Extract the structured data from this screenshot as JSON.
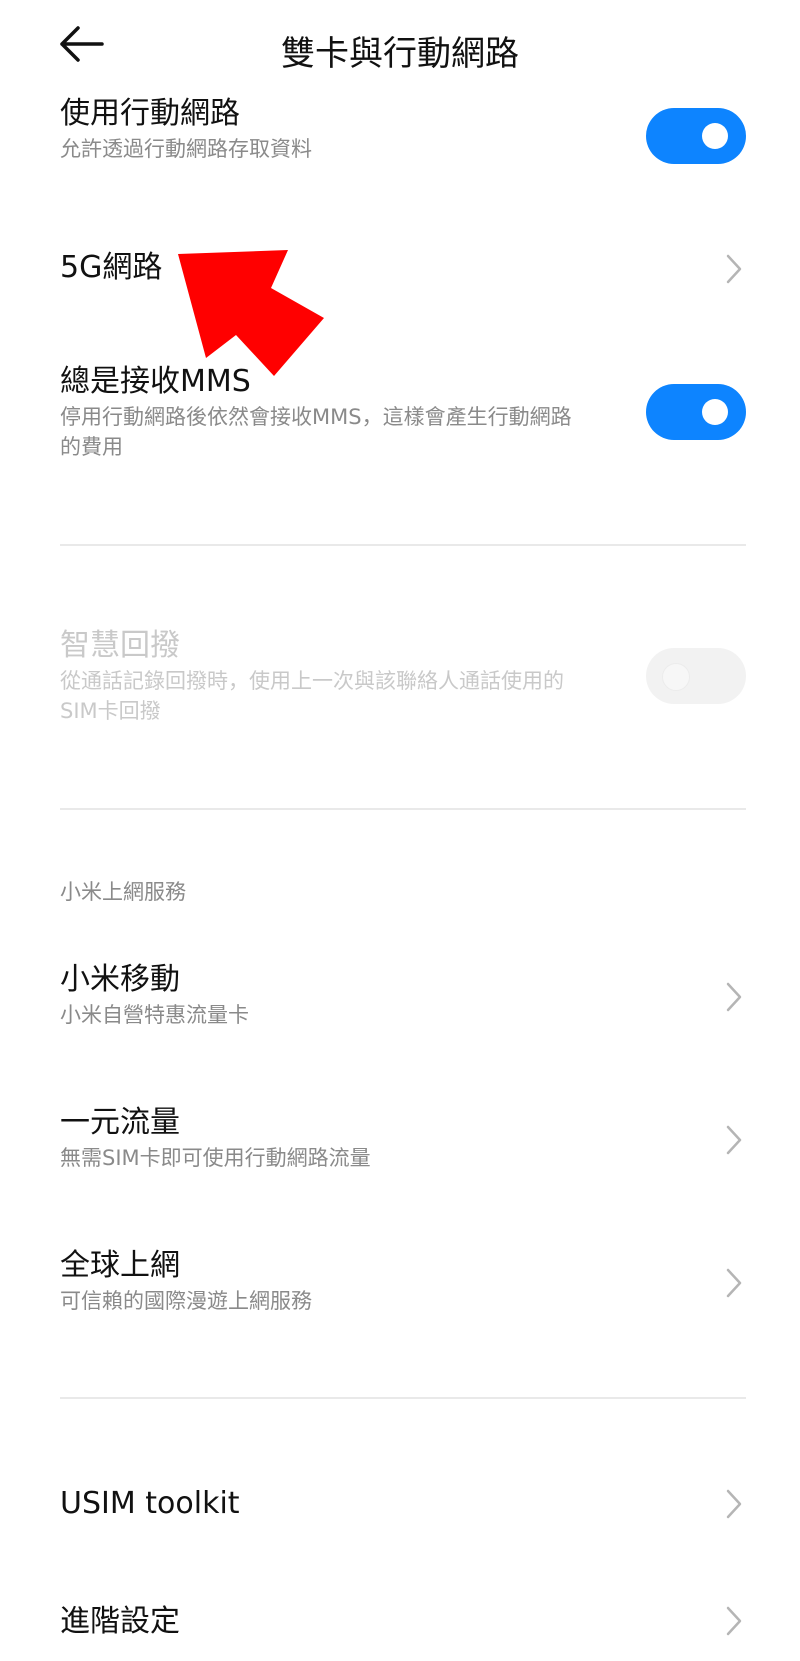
{
  "header": {
    "title": "雙卡與行動網路"
  },
  "mobile_data": {
    "title": "使用行動網路",
    "subtitle": "允許透過行動網路存取資料",
    "enabled": true
  },
  "network_5g": {
    "title": "5G網路"
  },
  "always_mms": {
    "title": "總是接收MMS",
    "subtitle_line1": "停用行動網路後依然會接收MMS，這樣會產生行動網路",
    "subtitle_line2": "的費用",
    "enabled": true
  },
  "smart_redial": {
    "title": "智慧回撥",
    "subtitle_line1": "從通話記錄回撥時，使用上一次與該聯絡人通話使用的",
    "subtitle_line2": "SIM卡回撥",
    "enabled": false,
    "disabled": true
  },
  "section": {
    "label": "小米上網服務"
  },
  "xiaomi_mobile": {
    "title": "小米移動",
    "subtitle": "小米自營特惠流量卡"
  },
  "one_yuan": {
    "title": "一元流量",
    "subtitle": "無需SIM卡即可使用行動網路流量"
  },
  "global_data": {
    "title": "全球上網",
    "subtitle": "可信賴的國際漫遊上網服務"
  },
  "usim": {
    "title": "USIM toolkit"
  },
  "advanced": {
    "title": "進階設定"
  },
  "colors": {
    "accent": "#0d84ff",
    "annotation_arrow": "#ff0000"
  }
}
